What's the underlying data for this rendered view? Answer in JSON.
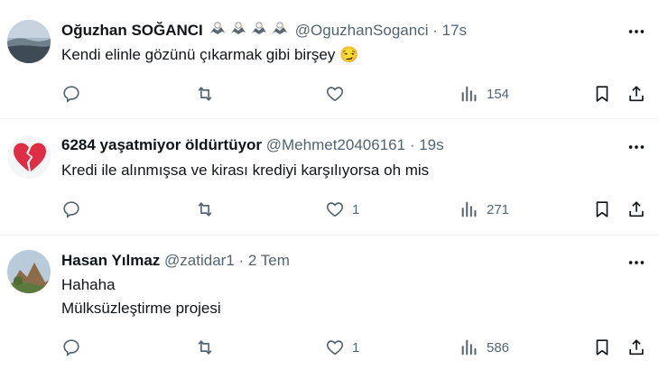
{
  "tweets": [
    {
      "name": "Oğuzhan SOĞANCI",
      "handle": "@OguzhanSoganci",
      "separator": "·",
      "time": "17s",
      "avatar_icon": "landscape-avatar",
      "badges": [
        "eagle-emoji",
        "eagle-emoji",
        "eagle-emoji",
        "eagle-emoji"
      ],
      "lines": [
        "Kendi elinle gözünü çıkarmak gibi birşey 😏"
      ],
      "counts": {
        "reply": "",
        "retweet": "",
        "like": "",
        "views": "154"
      }
    },
    {
      "name": "6284 yaşatmiyor öldürtüyor",
      "handle": "@Mehmet20406161",
      "separator": "·",
      "time": "19s",
      "avatar_icon": "broken-heart-avatar",
      "badges": [],
      "lines": [
        "Kredi ile alınmışsa ve kirası krediyi karşılıyorsa oh mis"
      ],
      "counts": {
        "reply": "",
        "retweet": "",
        "like": "1",
        "views": "271"
      }
    },
    {
      "name": "Hasan Yılmaz",
      "handle": "@zatidar1",
      "separator": "·",
      "time": "2 Tem",
      "avatar_icon": "rock-landscape-avatar",
      "badges": [],
      "lines": [
        "Hahaha",
        "Mülksüzleştirme projesi"
      ],
      "counts": {
        "reply": "",
        "retweet": "",
        "like": "1",
        "views": "586"
      }
    }
  ],
  "colors": {
    "text": "#0f1419",
    "muted": "#536471",
    "divider": "#eff3f4"
  }
}
